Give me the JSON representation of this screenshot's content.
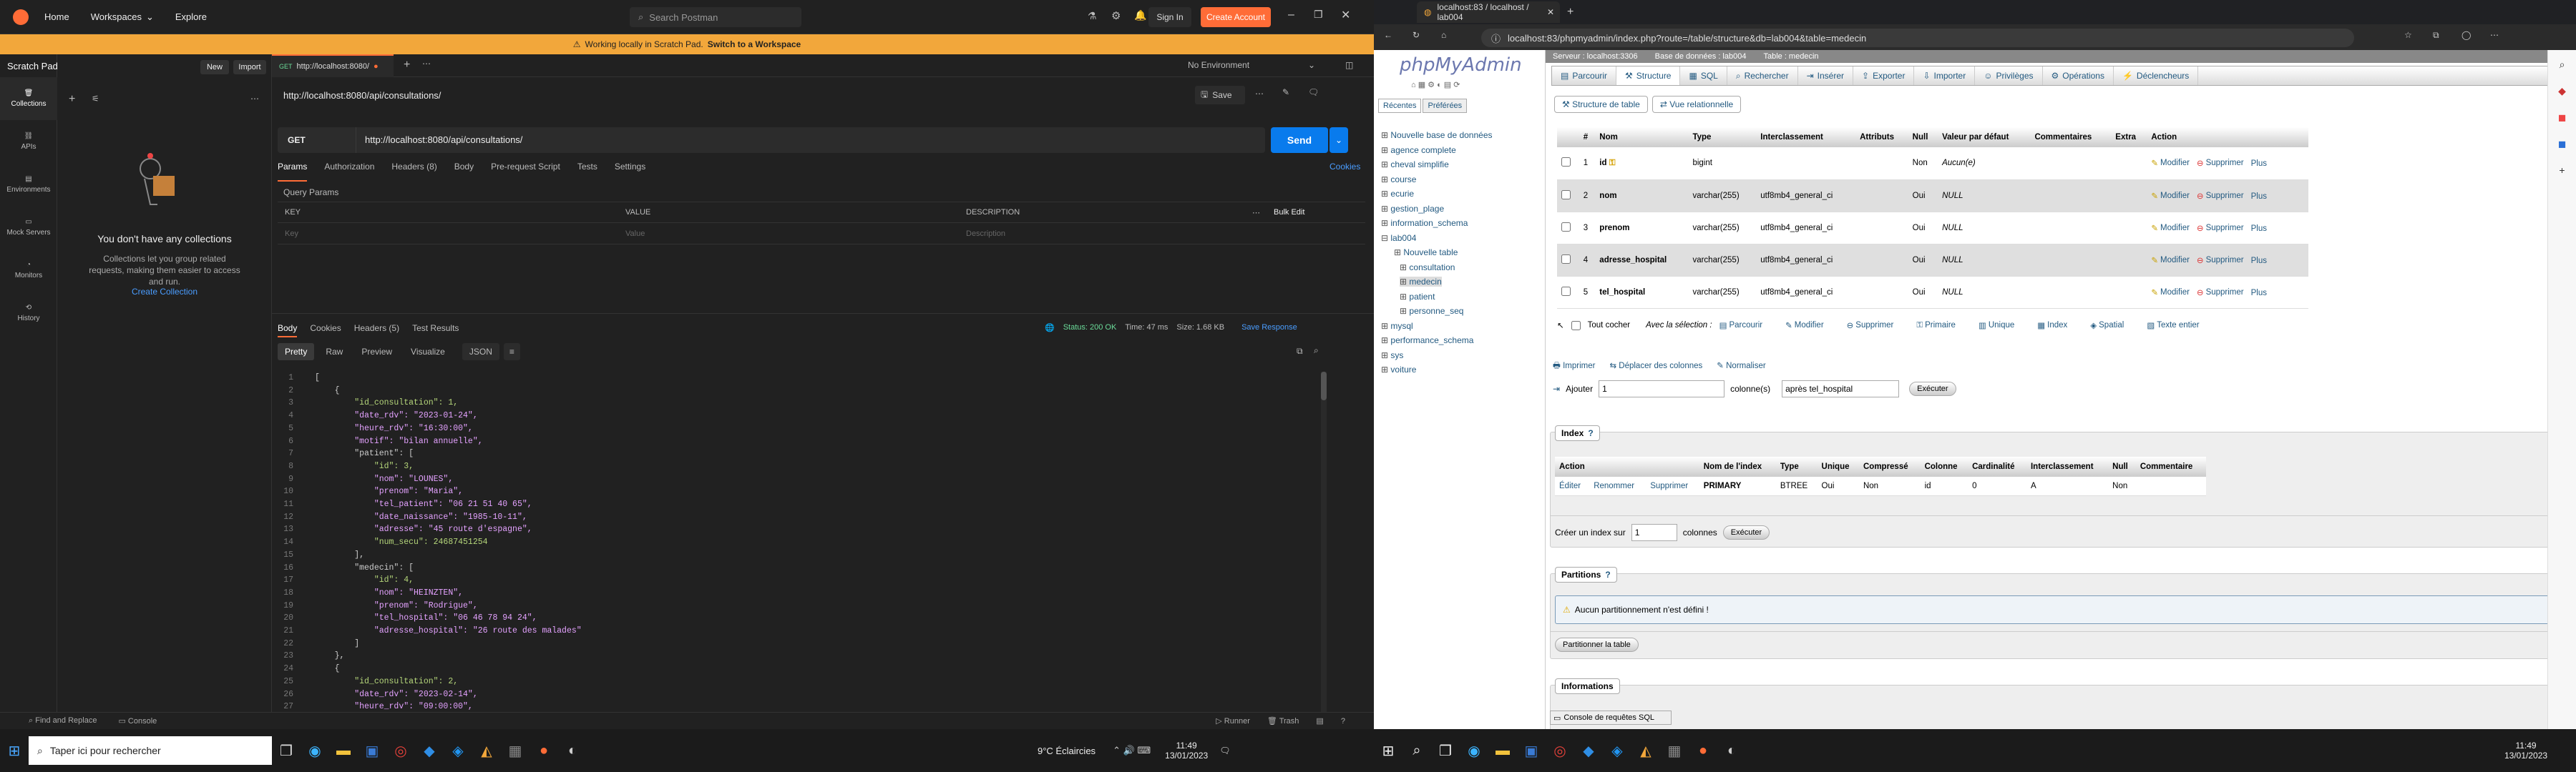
{
  "postman": {
    "nav": {
      "home": "Home",
      "workspaces": "Workspaces",
      "explore": "Explore"
    },
    "search_placeholder": "Search Postman",
    "sign_in": "Sign In",
    "create_account": "Create Account",
    "banner_text": "Working locally in Scratch Pad.",
    "banner_link": "Switch to a Workspace",
    "scratch_pad": "Scratch Pad",
    "new_btn": "New",
    "import_btn": "Import",
    "rail": [
      "Collections",
      "APIs",
      "Environments",
      "Mock Servers",
      "Monitors",
      "History"
    ],
    "empty_title": "You don't have any collections",
    "empty_desc": "Collections let you group related requests, making them easier to access and run.",
    "create_collection": "Create Collection",
    "tab_method": "GET",
    "tab_title": "http://localhost:8080/",
    "no_env": "No Environment",
    "request_title": "http://localhost:8080/api/consultations/",
    "save": "Save",
    "method": "GET",
    "url": "http://localhost:8080/api/consultations/",
    "send": "Send",
    "req_tabs": [
      "Params",
      "Authorization",
      "Headers (8)",
      "Body",
      "Pre-request Script",
      "Tests",
      "Settings"
    ],
    "cookies": "Cookies",
    "query_params": "Query Params",
    "kv_headers": [
      "KEY",
      "VALUE",
      "DESCRIPTION"
    ],
    "bulk_edit": "Bulk Edit",
    "kv_placeholders": [
      "Key",
      "Value",
      "Description"
    ],
    "resp_tabs": [
      "Body",
      "Cookies",
      "Headers (5)",
      "Test Results"
    ],
    "status": "Status: 200 OK",
    "time": "Time: 47 ms",
    "size": "Size: 1.68 KB",
    "save_response": "Save Response",
    "view_tabs": [
      "Pretty",
      "Raw",
      "Preview",
      "Visualize"
    ],
    "format": "JSON",
    "code_lines": [
      "[",
      "    {",
      "        \"id_consultation\": 1,",
      "        \"date_rdv\": \"2023-01-24\",",
      "        \"heure_rdv\": \"16:30:00\",",
      "        \"motif\": \"bilan annuelle\",",
      "        \"patient\": [",
      "            \"id\": 3,",
      "            \"nom\": \"LOUNES\",",
      "            \"prenom\": \"Maria\",",
      "            \"tel_patient\": \"06 21 51 40 65\",",
      "            \"date_naissance\": \"1985-10-11\",",
      "            \"adresse\": \"45 route d'espagne\",",
      "            \"num_secu\": 24687451254",
      "        ],",
      "        \"medecin\": [",
      "            \"id\": 4,",
      "            \"nom\": \"HEINZTEN\",",
      "            \"prenom\": \"Rodrigue\",",
      "            \"tel_hospital\": \"06 46 78 94 24\",",
      "            \"adresse_hospital\": \"26 route des malades\"",
      "        ]",
      "    },",
      "    {",
      "        \"id_consultation\": 2,",
      "        \"date_rdv\": \"2023-02-14\",",
      "        \"heure_rdv\": \"09:00:00\","
    ],
    "footer": {
      "find": "Find and Replace",
      "console": "Console",
      "runner": "Runner",
      "trash": "Trash"
    }
  },
  "taskbar_left": {
    "search_placeholder": "Taper ici pour rechercher",
    "weather": "9°C  Éclaircies",
    "time": "11:49",
    "date": "13/01/2023"
  },
  "browser": {
    "tab_title": "localhost:83 / localhost / lab004",
    "url": "localhost:83/phpmyadmin/index.php?route=/table/structure&db=lab004&table=medecin",
    "breadcrumb": [
      "Serveur : localhost:3306",
      "Base de données : lab004",
      "Table : medecin"
    ],
    "pma_logo": "phpMyAdmin",
    "left_tabs": [
      "Récentes",
      "Préférées"
    ],
    "tree": [
      "Nouvelle base de données",
      "agence complete",
      "cheval simplifie",
      "course",
      "ecurie",
      "gestion_plage",
      "information_schema",
      "lab004",
      "Nouvelle table",
      "consultation",
      "medecin",
      "patient",
      "personne_seq",
      "mysql",
      "performance_schema",
      "sys",
      "voiture"
    ],
    "tabs": [
      "Parcourir",
      "Structure",
      "SQL",
      "Rechercher",
      "Insérer",
      "Exporter",
      "Importer",
      "Privilèges",
      "Opérations",
      "Déclencheurs"
    ],
    "subtabs": [
      "Structure de table",
      "Vue relationnelle"
    ],
    "columns": [
      "#",
      "Nom",
      "Type",
      "Interclassement",
      "Attributs",
      "Null",
      "Valeur par défaut",
      "Commentaires",
      "Extra",
      "Action"
    ],
    "rows": [
      {
        "num": "1",
        "name": "id",
        "type": "bigint",
        "coll": "",
        "null": "Non",
        "default": "Aucun(e)"
      },
      {
        "num": "2",
        "name": "nom",
        "type": "varchar(255)",
        "coll": "utf8mb4_general_ci",
        "null": "Oui",
        "default": "NULL"
      },
      {
        "num": "3",
        "name": "prenom",
        "type": "varchar(255)",
        "coll": "utf8mb4_general_ci",
        "null": "Oui",
        "default": "NULL"
      },
      {
        "num": "4",
        "name": "adresse_hospital",
        "type": "varchar(255)",
        "coll": "utf8mb4_general_ci",
        "null": "Oui",
        "default": "NULL"
      },
      {
        "num": "5",
        "name": "tel_hospital",
        "type": "varchar(255)",
        "coll": "utf8mb4_general_ci",
        "null": "Oui",
        "default": "NULL"
      }
    ],
    "row_actions": [
      "Modifier",
      "Supprimer",
      "Plus"
    ],
    "check_all": "Tout cocher",
    "with_selection": "Avec la sélection :",
    "bulk_actions": [
      "Parcourir",
      "Modifier",
      "Supprimer",
      "Primaire",
      "Unique",
      "Index",
      "Spatial",
      "Texte entier"
    ],
    "links": [
      "Imprimer",
      "Déplacer des colonnes",
      "Normaliser"
    ],
    "add_label": "Ajouter",
    "add_value": "1",
    "add_columns": "colonne(s)",
    "add_after": "après tel_hospital",
    "execute": "Exécuter",
    "index_legend": "Index",
    "index_cols": [
      "Action",
      "Nom de l'index",
      "Type",
      "Unique",
      "Compressé",
      "Colonne",
      "Cardinalité",
      "Interclassement",
      "Null",
      "Commentaire"
    ],
    "index_row": [
      "Éditer",
      "Renommer",
      "Supprimer",
      "PRIMARY",
      "BTREE",
      "Oui",
      "Non",
      "id",
      "0",
      "A",
      "Non",
      ""
    ],
    "create_index": "Créer un index sur",
    "create_index_value": "1",
    "create_index_cols": "colonnes",
    "partitions_legend": "Partitions",
    "no_partition": "Aucun partitionnement n'est défini !",
    "partition_btn": "Partitionner la table",
    "info_legend": "Informations",
    "console": "Console de requêtes SQL"
  },
  "taskbar_right": {
    "time": "11:49",
    "date": "13/01/2023"
  },
  "colors": {
    "postman_orange": "#ff6c37",
    "banner": "#f2a73b",
    "send_blue": "#097bed",
    "pma_link": "#235a81"
  }
}
